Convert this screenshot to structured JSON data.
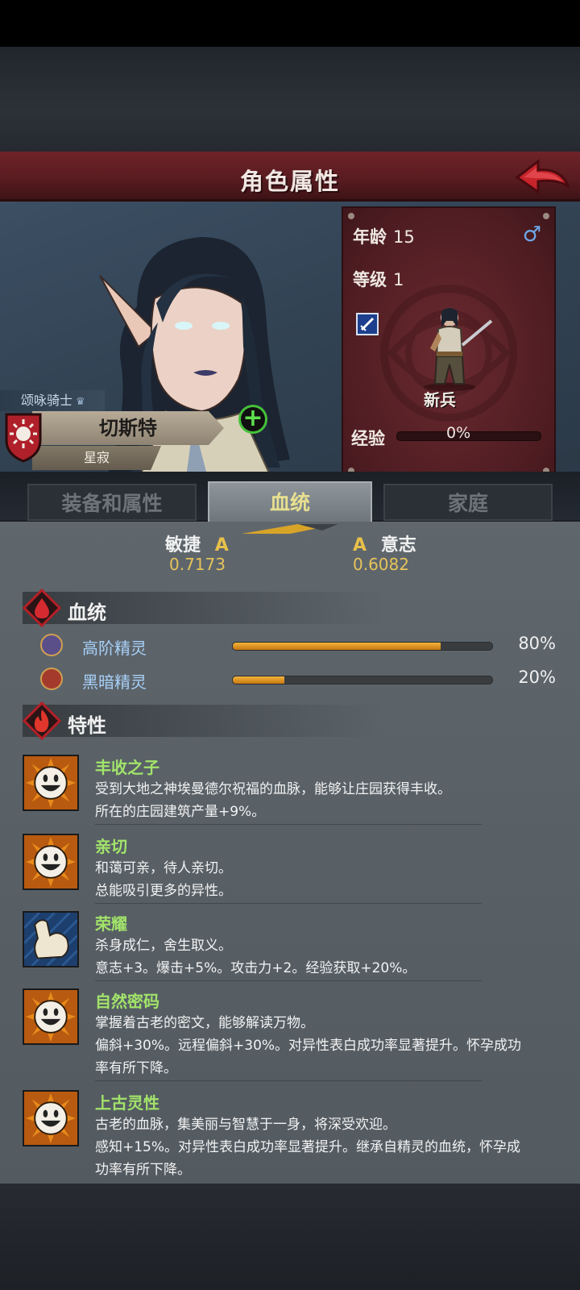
{
  "header": {
    "title": "角色属性"
  },
  "character": {
    "title_badge": "颂咏骑士",
    "name": "切斯特",
    "epithet": "星寂"
  },
  "info": {
    "age_label": "年龄",
    "age_value": "15",
    "level_label": "等级",
    "level_value": "1",
    "unit_class": "新兵",
    "exp_label": "经验",
    "exp_value": "0%",
    "gender_icon": "male-icon",
    "exp_progress": 0
  },
  "tabs": [
    {
      "label": "装备和属性",
      "active": false
    },
    {
      "label": "血统",
      "active": true
    },
    {
      "label": "家庭",
      "active": false
    }
  ],
  "stats": {
    "left": {
      "name": "敏捷",
      "grade": "A",
      "value": "0.7173"
    },
    "right": {
      "name": "意志",
      "grade": "A",
      "value": "0.6082"
    }
  },
  "bloodline": {
    "title": "血统",
    "items": [
      {
        "name": "高阶精灵",
        "percent_text": "80%",
        "percent": 80
      },
      {
        "name": "黑暗精灵",
        "percent_text": "20%",
        "percent": 20
      }
    ]
  },
  "traits": {
    "title": "特性",
    "items": [
      {
        "name": "丰收之子",
        "icon": "smiley-sun-icon",
        "lines": [
          "受到大地之神埃曼德尔祝福的血脉，能够让庄园获得丰收。",
          "所在的庄园建筑产量+9%。"
        ]
      },
      {
        "name": "亲切",
        "icon": "smiley-sun-icon",
        "lines": [
          "和蔼可亲，待人亲切。",
          "总能吸引更多的异性。"
        ]
      },
      {
        "name": "荣耀",
        "icon": "flexed-arm-icon",
        "lines": [
          "杀身成仁，舍生取义。",
          "意志+3。爆击+5%。攻击力+2。经验获取+20%。"
        ]
      },
      {
        "name": "自然密码",
        "icon": "smiley-sun-icon",
        "lines": [
          "掌握着古老的密文，能够解读万物。",
          "偏斜+30%。远程偏斜+30%。对异性表白成功率显著提升。怀孕成功",
          "率有所下降。"
        ]
      },
      {
        "name": "上古灵性",
        "icon": "smiley-sun-icon",
        "lines": [
          "古老的血脉，集美丽与智慧于一身，将深受欢迎。",
          "感知+15%。对异性表白成功率显著提升。继承自精灵的血统，怀孕成",
          "功率有所下降。"
        ]
      }
    ]
  },
  "colors": {
    "title_bar": "#6e2328",
    "trait_name": "#a2e36a",
    "bloodline_name": "#a8d0f8",
    "stat_value": "#e6c25a",
    "bar_fill": "#f3b33a"
  }
}
